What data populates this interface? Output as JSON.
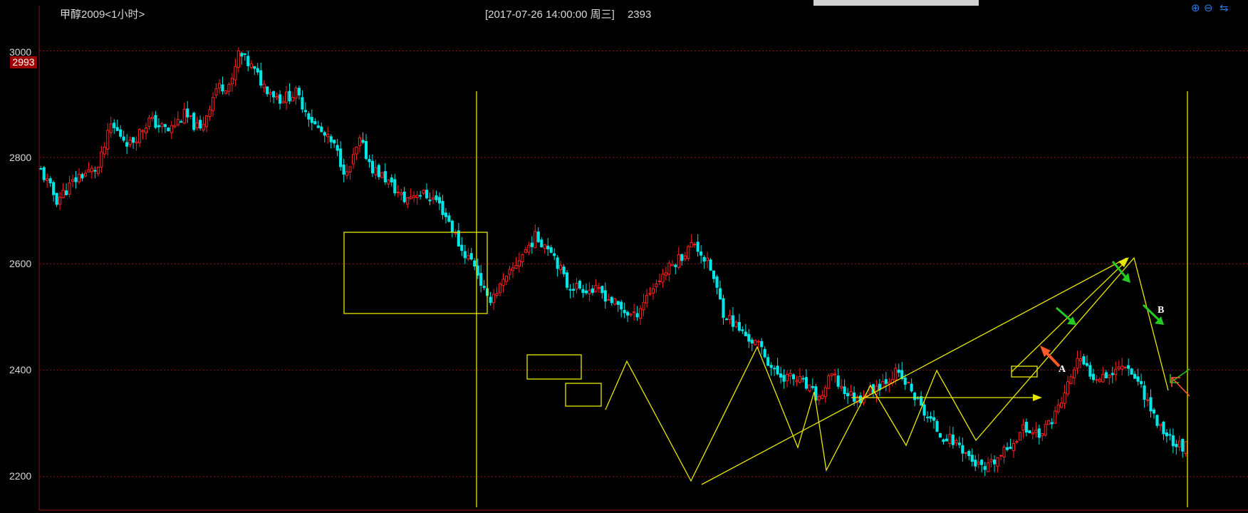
{
  "header": {
    "symbol": "甲醇2009<1小时>",
    "datetime": "[2017-07-26  14:00:00 周三]",
    "price": "2393"
  },
  "price_badge": "2993",
  "toolbar": {
    "zoom_in": "zoom-in-icon",
    "zoom_out": "zoom-out-icon",
    "pan": "pan-arrows-icon"
  },
  "colors": {
    "up": "#ff2020",
    "down": "#00e5e5",
    "drawing": "#ffff00",
    "green_arrow": "#22cc22",
    "orange_arrow": "#ff5a28",
    "grid": "#8a1414"
  },
  "annotations": {
    "a": "A",
    "b": "B"
  },
  "chart_data": {
    "type": "line",
    "series_name": "",
    "y_ticks": [
      "3000",
      "2800",
      "2600",
      "2400",
      "2200"
    ],
    "tick_values": [
      3000,
      2800,
      2600,
      2400,
      2200
    ],
    "ylim": [
      2137,
      3085
    ],
    "bar_count": 360,
    "close_path": [
      [
        0,
        2775
      ],
      [
        5,
        2720
      ],
      [
        12,
        2765
      ],
      [
        18,
        2780
      ],
      [
        22,
        2860
      ],
      [
        28,
        2825
      ],
      [
        34,
        2870
      ],
      [
        40,
        2850
      ],
      [
        45,
        2880
      ],
      [
        50,
        2850
      ],
      [
        55,
        2930
      ],
      [
        60,
        2940
      ],
      [
        62,
        2995
      ],
      [
        66,
        2970
      ],
      [
        70,
        2935
      ],
      [
        75,
        2910
      ],
      [
        80,
        2920
      ],
      [
        86,
        2860
      ],
      [
        92,
        2820
      ],
      [
        96,
        2765
      ],
      [
        100,
        2830
      ],
      [
        104,
        2780
      ],
      [
        108,
        2760
      ],
      [
        114,
        2720
      ],
      [
        118,
        2735
      ],
      [
        124,
        2720
      ],
      [
        128,
        2680
      ],
      [
        132,
        2625
      ],
      [
        136,
        2600
      ],
      [
        140,
        2530
      ],
      [
        146,
        2570
      ],
      [
        150,
        2610
      ],
      [
        155,
        2650
      ],
      [
        160,
        2630
      ],
      [
        165,
        2560
      ],
      [
        170,
        2555
      ],
      [
        176,
        2545
      ],
      [
        182,
        2515
      ],
      [
        186,
        2500
      ],
      [
        190,
        2540
      ],
      [
        195,
        2580
      ],
      [
        200,
        2610
      ],
      [
        205,
        2640
      ],
      [
        210,
        2590
      ],
      [
        214,
        2510
      ],
      [
        220,
        2470
      ],
      [
        226,
        2440
      ],
      [
        230,
        2395
      ],
      [
        238,
        2380
      ],
      [
        244,
        2345
      ],
      [
        248,
        2390
      ],
      [
        252,
        2360
      ],
      [
        256,
        2345
      ],
      [
        262,
        2370
      ],
      [
        268,
        2395
      ],
      [
        272,
        2370
      ],
      [
        276,
        2330
      ],
      [
        282,
        2280
      ],
      [
        288,
        2260
      ],
      [
        292,
        2230
      ],
      [
        296,
        2210
      ],
      [
        302,
        2245
      ],
      [
        308,
        2290
      ],
      [
        314,
        2280
      ],
      [
        320,
        2340
      ],
      [
        325,
        2420
      ],
      [
        330,
        2390
      ],
      [
        336,
        2395
      ],
      [
        340,
        2415
      ],
      [
        345,
        2370
      ],
      [
        350,
        2300
      ],
      [
        356,
        2260
      ],
      [
        360,
        2255
      ]
    ]
  }
}
